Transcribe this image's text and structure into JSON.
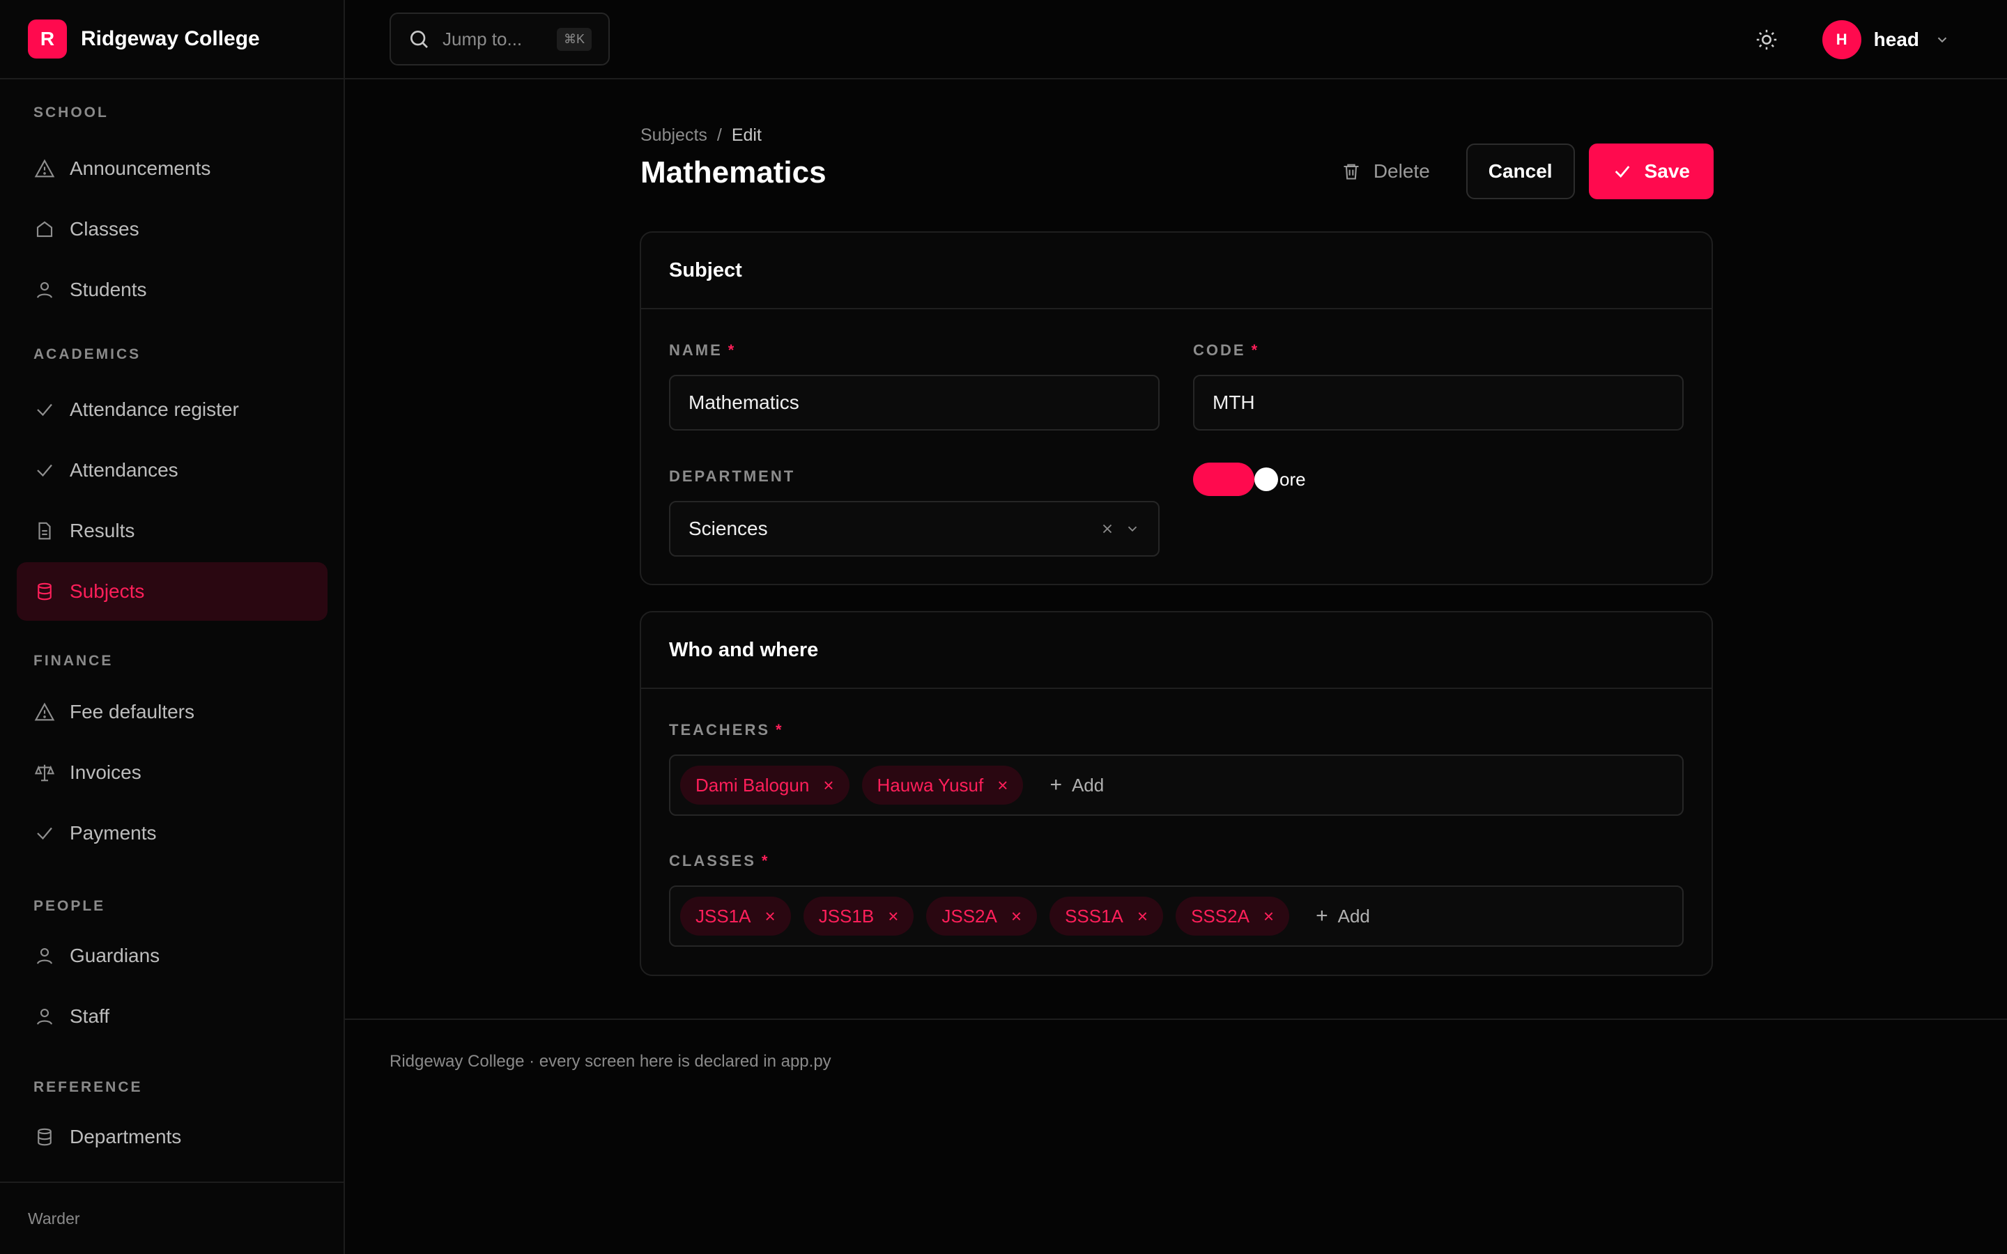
{
  "brand": {
    "logo_letter": "R",
    "name": "Ridgeway College"
  },
  "nav": {
    "sections": [
      {
        "title": "SCHOOL",
        "items": [
          {
            "label": "Announcements",
            "icon": "alert-triangle-icon"
          },
          {
            "label": "Classes",
            "icon": "home-icon"
          },
          {
            "label": "Students",
            "icon": "user-icon"
          }
        ]
      },
      {
        "title": "ACADEMICS",
        "items": [
          {
            "label": "Attendance register",
            "icon": "check-icon"
          },
          {
            "label": "Attendances",
            "icon": "check-icon"
          },
          {
            "label": "Results",
            "icon": "file-icon"
          },
          {
            "label": "Subjects",
            "icon": "database-icon",
            "active": true
          }
        ]
      },
      {
        "title": "FINANCE",
        "items": [
          {
            "label": "Fee defaulters",
            "icon": "alert-triangle-icon"
          },
          {
            "label": "Invoices",
            "icon": "scale-icon"
          },
          {
            "label": "Payments",
            "icon": "check-icon"
          }
        ]
      },
      {
        "title": "PEOPLE",
        "items": [
          {
            "label": "Guardians",
            "icon": "user-icon"
          },
          {
            "label": "Staff",
            "icon": "user-icon"
          }
        ]
      },
      {
        "title": "REFERENCE",
        "items": [
          {
            "label": "Departments",
            "icon": "database-icon"
          }
        ]
      }
    ],
    "footer": "Warder"
  },
  "topbar": {
    "search_placeholder": "Jump to...",
    "shortcut": "⌘K",
    "user_initial": "H",
    "user_name": "head"
  },
  "page": {
    "breadcrumb": [
      "Subjects",
      "Edit"
    ],
    "breadcrumb_sep": "/",
    "title": "Mathematics",
    "actions": {
      "delete": "Delete",
      "cancel": "Cancel",
      "save": "Save"
    }
  },
  "subject_card": {
    "title": "Subject",
    "name_label": "NAME",
    "name_value": "Mathematics",
    "code_label": "CODE",
    "code_value": "MTH",
    "department_label": "DEPARTMENT",
    "department_value": "Sciences",
    "core_toggle_label": "ore",
    "core_toggle_on": true,
    "required_mark": "*"
  },
  "who_card": {
    "title": "Who and where",
    "teachers_label": "TEACHERS",
    "teachers": [
      "Dami Balogun",
      "Hauwa Yusuf"
    ],
    "classes_label": "CLASSES",
    "classes": [
      "JSS1A",
      "JSS1B",
      "JSS2A",
      "SSS1A",
      "SSS2A"
    ],
    "add_label": "Add",
    "remove_glyph": "×"
  },
  "footer": {
    "text": "Ridgeway College · every screen here is declared in app.py"
  },
  "colors": {
    "accent": "#ff0a4e",
    "active_bg": "#2a0711",
    "background": "#050505"
  }
}
